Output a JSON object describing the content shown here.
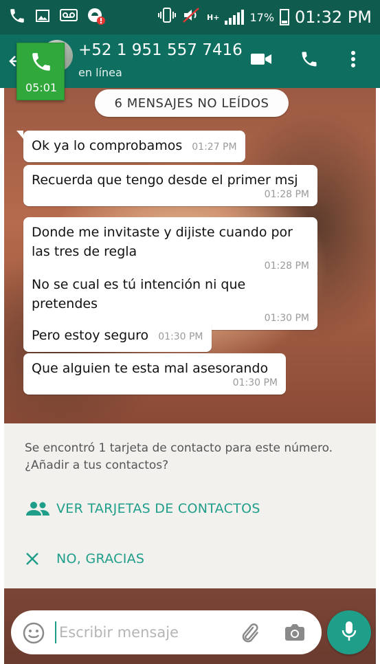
{
  "status_bar": {
    "battery": "17%",
    "time": "01:32 PM",
    "network": "H+"
  },
  "header": {
    "contact_name": "+52 1 951 557 7416",
    "status": "en línea"
  },
  "call": {
    "timer": "05:01"
  },
  "chat": {
    "unread_banner": "6 MENSAJES NO LEÍDOS",
    "messages": [
      {
        "text": "Ok ya lo comprobamos",
        "time": "01:27 PM"
      },
      {
        "text": "Recuerda que tengo desde el primer msj",
        "time": "01:28 PM"
      },
      {
        "text": "Donde me invitaste y dijiste cuando por las tres de regla",
        "time": "01:28 PM"
      },
      {
        "text": "No se cual es tú intención ni que pretendes",
        "time": "01:30 PM"
      },
      {
        "text": "Pero estoy seguro",
        "time": "01:30 PM"
      },
      {
        "text": "Que alguien te esta mal asesorando",
        "time": "01:30 PM"
      }
    ]
  },
  "contact_card": {
    "message": "Se encontró 1 tarjeta de contacto para este número. ¿Añadir a tus contactos?",
    "view_label": "VER TARJETAS DE CONTACTOS",
    "dismiss_label": "NO, GRACIAS"
  },
  "composer": {
    "placeholder": "Escribir mensaje"
  },
  "colors": {
    "header": "#0e6f60",
    "status_bar": "#0f5c4e",
    "accent": "#1f9e8a",
    "call_badge": "#31a83c"
  },
  "icons": [
    "phone-icon",
    "gallery-icon",
    "voicemail-icon",
    "alert-icon",
    "vibrate-icon",
    "mute-icon",
    "signal-icon",
    "battery-icon",
    "back-arrow-icon",
    "video-call-icon",
    "voice-call-icon",
    "overflow-menu-icon",
    "contacts-group-icon",
    "close-icon",
    "emoji-icon",
    "attach-icon",
    "camera-icon",
    "mic-icon"
  ]
}
